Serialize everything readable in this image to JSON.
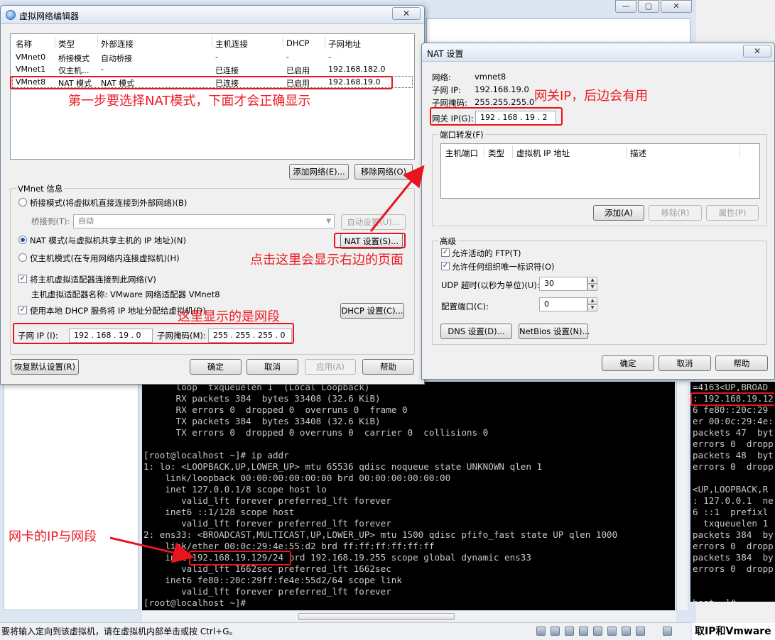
{
  "colors": {
    "annotation": "#e8141e",
    "terminal_bg": "#000000",
    "terminal_fg": "#c8c8c8",
    "dialog_bg": "#f0f0f0"
  },
  "background_window": {
    "controls": [
      "—",
      "▢",
      "✕"
    ]
  },
  "status_bar": {
    "text": "要将输入定向到该虚拟机，请在虚拟机内部单击或按 Ctrl+G。"
  },
  "right_bottom_text": "取IP和Vmware",
  "terminal_main": {
    "lines": [
      "      loop  txqueuelen 1  (Local Loopback)",
      "      RX packets 384  bytes 33408 (32.6 KiB)",
      "      RX errors 0  dropped 0  overruns 0  frame 0",
      "      TX packets 384  bytes 33408 (32.6 KiB)",
      "      TX errors 0  dropped 0 overruns 0  carrier 0  collisions 0",
      "",
      "[root@localhost ~]# ip addr",
      "1: lo: <LOOPBACK,UP,LOWER_UP> mtu 65536 qdisc noqueue state UNKNOWN qlen 1",
      "    link/loopback 00:00:00:00:00:00 brd 00:00:00:00:00:00",
      "    inet 127.0.0.1/8 scope host lo",
      "       valid_lft forever preferred_lft forever",
      "    inet6 ::1/128 scope host",
      "       valid_lft forever preferred_lft forever",
      "2: ens33: <BROADCAST,MULTICAST,UP,LOWER_UP> mtu 1500 qdisc pfifo_fast state UP qlen 1000",
      "    link/ether 00:0c:29:4e:55:d2 brd ff:ff:ff:ff:ff:ff",
      "    inet 192.168.19.129/24 brd 192.168.19.255 scope global dynamic ens33",
      "       valid_lft 1662sec preferred_lft 1662sec",
      "    inet6 fe80::20c:29ff:fe4e:55d2/64 scope link",
      "       valid_lft forever preferred_lft forever",
      "[root@localhost ~]#"
    ]
  },
  "terminal_right": {
    "lines": [
      "=4163<UP,BROAD",
      ": 192.168.19.12",
      "6 fe80::20c:29",
      "er 00:0c:29:4e:",
      "packets 47  byt",
      "errors 0  dropp",
      "packets 48  byt",
      "errors 0  dropp",
      "",
      "<UP,LOOPBACK,R",
      ": 127.0.0.1  ne",
      "6 ::1  prefixl",
      "  txqueuelen 1",
      "packets 384  by",
      "errors 0  dropp",
      "packets 384  by",
      "errors 0  dropp",
      "",
      "",
      "host ~]#"
    ]
  },
  "vnet_editor": {
    "title": "虚拟网络编辑器",
    "close": "✕",
    "columns": [
      "名称",
      "类型",
      "外部连接",
      "主机连接",
      "DHCP",
      "子网地址"
    ],
    "rows": [
      [
        "VMnet0",
        "桥接模式",
        "自动桥接",
        "-",
        "-",
        "-"
      ],
      [
        "VMnet1",
        "仅主机...",
        "-",
        "已连接",
        "已启用",
        "192.168.182.0"
      ],
      [
        "VMnet8",
        "NAT 模式",
        "NAT 模式",
        "已连接",
        "已启用",
        "192.168.19.0"
      ]
    ],
    "add_network": "添加网络(E)...",
    "remove_network": "移除网络(O)",
    "vmnet_info": "VMnet 信息",
    "bridge_mode": "桥接模式(将虚拟机直接连接到外部网络)(B)",
    "bridge_to_label": "桥接到(T):",
    "bridge_to_value": "自动",
    "auto_settings": "自动设置(U)...",
    "nat_mode": "NAT 模式(与虚拟机共享主机的 IP 地址)(N)",
    "nat_settings": "NAT 设置(S)...",
    "host_only": "仅主机模式(在专用网络内连接虚拟机)(H)",
    "connect_adapter": "将主机虚拟适配器连接到此网络(V)",
    "adapter_name": "主机虚拟适配器名称: VMware 网络适配器 VMnet8",
    "use_dhcp": "使用本地 DHCP 服务将 IP 地址分配给虚拟机(D)",
    "dhcp_settings": "DHCP 设置(C)...",
    "subnet_ip_label": "子网 IP (I):",
    "subnet_ip": "192 . 168 . 19  .  0",
    "subnet_mask_label": "子网掩码(M):",
    "subnet_mask": "255 . 255 . 255 .  0",
    "restore": "恢复默认设置(R)",
    "ok": "确定",
    "cancel": "取消",
    "apply": "应用(A)",
    "help": "帮助"
  },
  "nat_dialog": {
    "title": "NAT 设置",
    "close": "✕",
    "network_label": "网络:",
    "network_value": "vmnet8",
    "subnet_ip_label": "子网 IP:",
    "subnet_ip_value": "192.168.19.0",
    "subnet_mask_label": "子网掩码:",
    "subnet_mask_value": "255.255.255.0",
    "gateway_label": "网关 IP(G):",
    "gateway_value": "192 . 168 . 19  .  2",
    "port_forward": "端口转发(F)",
    "port_columns": [
      "主机端口",
      "类型",
      "虚拟机 IP 地址",
      "描述"
    ],
    "add": "添加(A)",
    "remove": "移除(R)",
    "properties": "属性(P)",
    "advanced": "高级",
    "allow_ftp": "允许活动的 FTP(T)",
    "allow_uid": "允许任何组织唯一标识符(O)",
    "udp_timeout_label": "UDP 超时(以秒为单位)(U):",
    "udp_timeout_value": "30",
    "config_port_label": "配置端口(C):",
    "config_port_value": "0",
    "dns_settings": "DNS 设置(D)...",
    "netbios_settings": "NetBios 设置(N)...",
    "ok": "确定",
    "cancel": "取消",
    "help": "帮助"
  },
  "annotations": {
    "step1": "第一步要选择NAT模式，下面才会正确显示",
    "gateway": "网关IP，后边会有用",
    "click_here": "点击这里会显示右边的页面",
    "subnet": "这里显示的是网段",
    "nic_ip": "网卡的IP与网段"
  }
}
